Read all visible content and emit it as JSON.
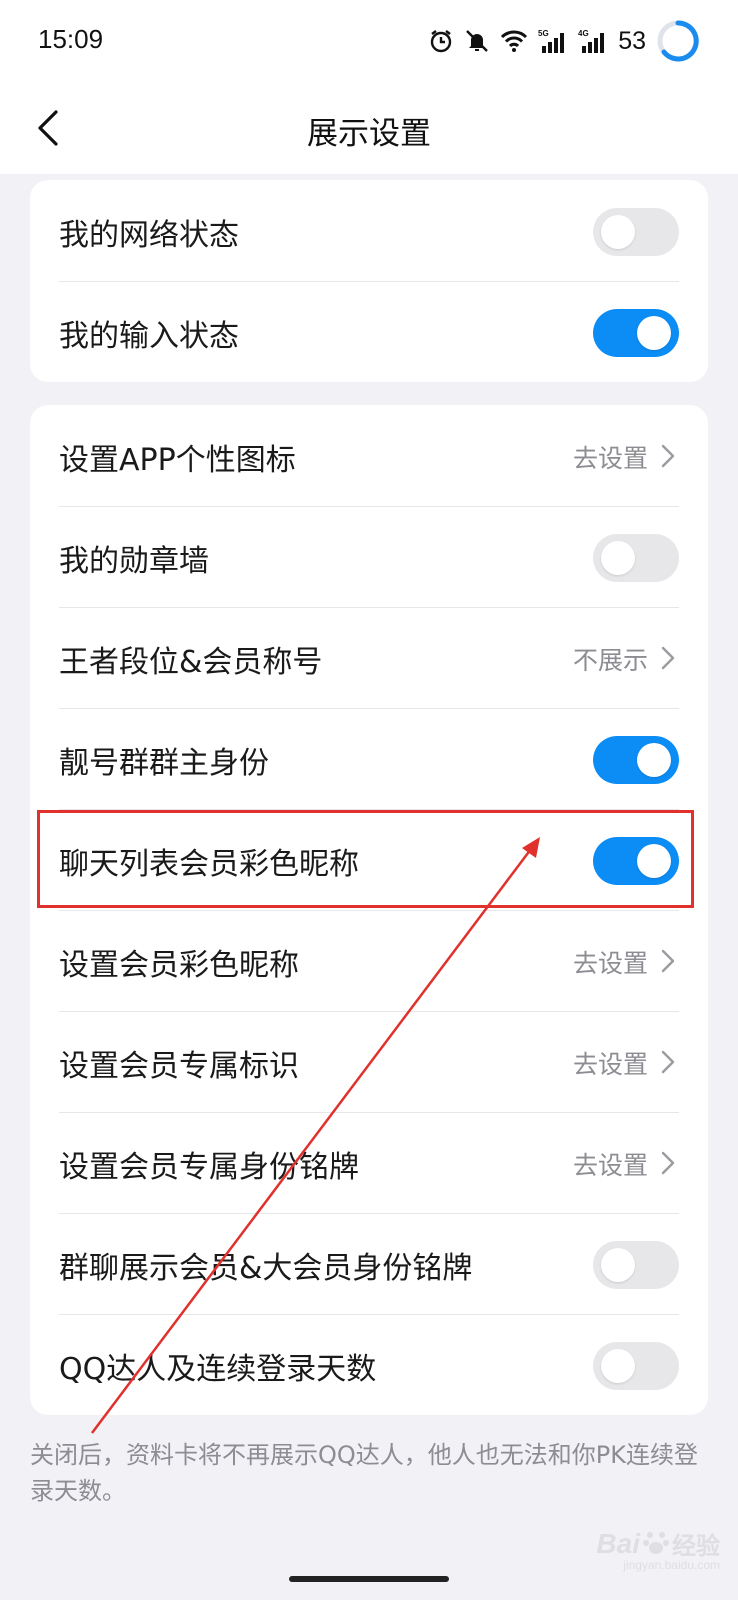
{
  "status_bar": {
    "time": "15:09",
    "battery": "53",
    "net_labels": [
      "5G",
      "4G"
    ],
    "icons": [
      "alarm-icon",
      "mute-icon",
      "wifi-icon",
      "signal-5g-icon",
      "signal-4g-icon",
      "battery-ring-icon"
    ]
  },
  "header": {
    "title": "展示设置",
    "back_icon": "chevron-left-icon"
  },
  "group1": [
    {
      "label": "我的网络状态",
      "type": "toggle",
      "on": false
    },
    {
      "label": "我的输入状态",
      "type": "toggle",
      "on": true
    }
  ],
  "group2": [
    {
      "label": "设置APP个性图标",
      "type": "link",
      "value": "去设置"
    },
    {
      "label": "我的勋章墙",
      "type": "toggle",
      "on": false
    },
    {
      "label": "王者段位&会员称号",
      "type": "link",
      "value": "不展示"
    },
    {
      "label": "靓号群群主身份",
      "type": "toggle",
      "on": true
    },
    {
      "label": "聊天列表会员彩色昵称",
      "type": "toggle",
      "on": true
    },
    {
      "label": "设置会员彩色昵称",
      "type": "link",
      "value": "去设置"
    },
    {
      "label": "设置会员专属标识",
      "type": "link",
      "value": "去设置"
    },
    {
      "label": "设置会员专属身份铭牌",
      "type": "link",
      "value": "去设置"
    },
    {
      "label": "群聊展示会员&大会员身份铭牌",
      "type": "toggle",
      "on": false
    },
    {
      "label": "QQ达人及连续登录天数",
      "type": "toggle",
      "on": false
    }
  ],
  "footnote": "关闭后，资料卡将不再展示QQ达人，他人也无法和你PK连续登录天数。",
  "watermark": {
    "text": "Bai",
    "cn": "经验",
    "sub": "jingyan.baidu.com"
  },
  "colors": {
    "accent": "#0c8cf5",
    "annotation": "#e0312c",
    "background": "#f1f1f6"
  }
}
